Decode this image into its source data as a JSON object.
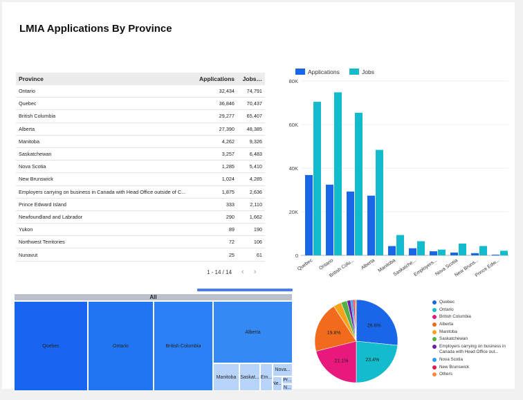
{
  "title": "LMIA Applications By Province",
  "table": {
    "headers": [
      "Province",
      "Applications",
      "Jobs…"
    ],
    "rows": [
      [
        "Ontario",
        "32,434",
        "74,791"
      ],
      [
        "Quebec",
        "36,846",
        "70,437"
      ],
      [
        "British Columbia",
        "29,277",
        "65,407"
      ],
      [
        "Alberta",
        "27,390",
        "48,385"
      ],
      [
        "Manitoba",
        "4,262",
        "9,326"
      ],
      [
        "Saskatchewan",
        "3,257",
        "6,483"
      ],
      [
        "Nova Scotia",
        "1,285",
        "5,410"
      ],
      [
        "New Brunswick",
        "1,024",
        "4,285"
      ],
      [
        "Employers carrying on business in Canada with Head Office outside of C...",
        "1,875",
        "2,636"
      ],
      [
        "Prince Edward Island",
        "333",
        "2,110"
      ],
      [
        "Newfoundland and Labrador",
        "290",
        "1,662"
      ],
      [
        "Yukon",
        "89",
        "190"
      ],
      [
        "Northwest Territories",
        "72",
        "106"
      ],
      [
        "Nunavut",
        "25",
        "61"
      ]
    ],
    "pagination": "1 - 14 / 14",
    "prev": "‹",
    "next": "›"
  },
  "colors": {
    "applications": "#1a66e8",
    "jobs": "#12bccd"
  },
  "chart_data": [
    {
      "type": "bar",
      "categories": [
        "Quebec",
        "Ontario",
        "British Colu...",
        "Alberta",
        "Manitoba",
        "Saskatche...",
        "Employers...",
        "Nova Scotia",
        "New Bruns...",
        "Prince Edw..."
      ],
      "series": [
        {
          "name": "Applications",
          "values": [
            36846,
            32434,
            29277,
            27390,
            4262,
            3257,
            1875,
            1285,
            1024,
            333
          ]
        },
        {
          "name": "Jobs",
          "values": [
            70437,
            74791,
            65407,
            48385,
            9326,
            6483,
            2636,
            5410,
            4285,
            2110
          ]
        }
      ],
      "yticks": [
        "0",
        "20K",
        "40K",
        "60K",
        "80K"
      ],
      "ylim": [
        0,
        80000
      ],
      "legend": "top-left"
    },
    {
      "type": "pie",
      "labels": [
        "Quebec",
        "Ontario",
        "British Columbia",
        "Alberta",
        "Manitoba",
        "Saskatchewan",
        "Employers carrying on business in Canada with Head Office out...",
        "Nova Scotia",
        "New Brunswick",
        "Others"
      ],
      "values": [
        26.6,
        23.4,
        21.1,
        19.8,
        3.1,
        2.4,
        1.4,
        0.9,
        0.7,
        0.6
      ],
      "slice_labels": [
        "26.6%",
        "23.4%",
        "21.1%",
        "19.8%",
        "",
        "",
        "",
        "",
        "",
        ""
      ],
      "colors": [
        "#1a66e8",
        "#12bccd",
        "#e8187c",
        "#f26b1d",
        "#f7a21b",
        "#56b04a",
        "#6a1fa8",
        "#2e9af0",
        "#e0194f",
        "#ff8a3d"
      ],
      "legend": "right"
    },
    {
      "type": "treemap",
      "root": "All",
      "items": [
        {
          "label": "Quebec",
          "value": 36846
        },
        {
          "label": "Ontario",
          "value": 32434
        },
        {
          "label": "British Columbia",
          "value": 29277
        },
        {
          "label": "Alberta",
          "value": 27390
        },
        {
          "label": "Manitoba",
          "value": 4262
        },
        {
          "label": "Saskat...",
          "value": 3257
        },
        {
          "label": "Em...",
          "value": 1875
        },
        {
          "label": "Nova...",
          "value": 1285
        },
        {
          "label": "Ne...",
          "value": 1024
        },
        {
          "label": "Pr...",
          "value": 333
        },
        {
          "label": "N...",
          "value": 290
        }
      ],
      "colors": [
        "#1765f0",
        "#2275f2",
        "#2a80f4",
        "#3489f5",
        "#b8d4fb"
      ]
    }
  ]
}
